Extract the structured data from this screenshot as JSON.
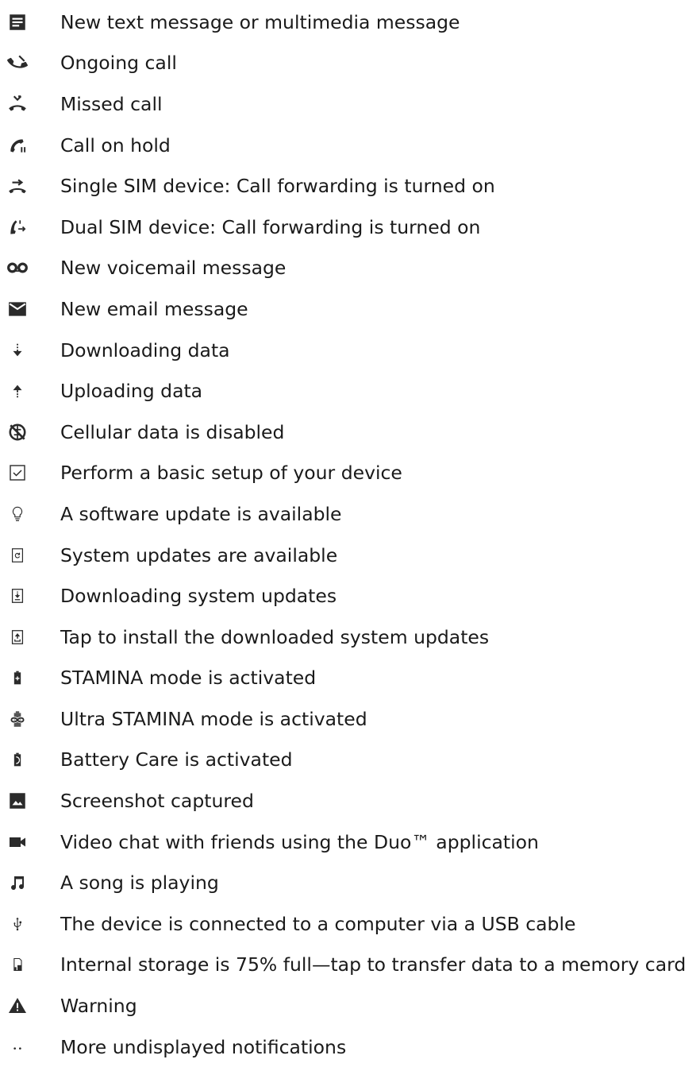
{
  "items": [
    {
      "icon": "text-message-icon",
      "label": "New text message or multimedia message"
    },
    {
      "icon": "ongoing-call-icon",
      "label": "Ongoing call"
    },
    {
      "icon": "missed-call-icon",
      "label": "Missed call"
    },
    {
      "icon": "call-on-hold-icon",
      "label": "Call on hold"
    },
    {
      "icon": "call-forwarding-icon",
      "label": "Single SIM device: Call forwarding is turned on"
    },
    {
      "icon": "dual-sim-call-forwarding-icon",
      "label": "Dual SIM device: Call forwarding is turned on"
    },
    {
      "icon": "voicemail-icon",
      "label": "New voicemail message"
    },
    {
      "icon": "email-icon",
      "label": "New email message"
    },
    {
      "icon": "download-icon",
      "label": "Downloading data"
    },
    {
      "icon": "upload-icon",
      "label": "Uploading data"
    },
    {
      "icon": "cellular-data-disabled-icon",
      "label": "Cellular data is disabled"
    },
    {
      "icon": "setup-checkbox-icon",
      "label": "Perform a basic setup of your device"
    },
    {
      "icon": "lightbulb-icon",
      "label": "A software update is available"
    },
    {
      "icon": "system-update-icon",
      "label": "System updates are available"
    },
    {
      "icon": "downloading-system-update-icon",
      "label": "Downloading system updates"
    },
    {
      "icon": "install-system-update-icon",
      "label": "Tap to install the downloaded system updates"
    },
    {
      "icon": "stamina-battery-icon",
      "label": "STAMINA mode is activated"
    },
    {
      "icon": "ultra-stamina-icon",
      "label": "Ultra STAMINA mode is activated"
    },
    {
      "icon": "battery-care-icon",
      "label": "Battery Care is activated"
    },
    {
      "icon": "screenshot-icon",
      "label": "Screenshot captured"
    },
    {
      "icon": "video-camera-icon",
      "label": "Video chat with friends using the Duo™ application"
    },
    {
      "icon": "music-note-icon",
      "label": "A song is playing"
    },
    {
      "icon": "usb-icon",
      "label": "The device is connected to a computer via a USB cable"
    },
    {
      "icon": "storage-card-icon",
      "label": "Internal storage is 75% full—tap to transfer data to a memory card"
    },
    {
      "icon": "warning-icon",
      "label": "Warning"
    },
    {
      "icon": "more-notifications-icon",
      "label": "More undisplayed notifications"
    }
  ],
  "colors": {
    "text": "#1a1a1a",
    "icon": "#2b2b2b"
  }
}
